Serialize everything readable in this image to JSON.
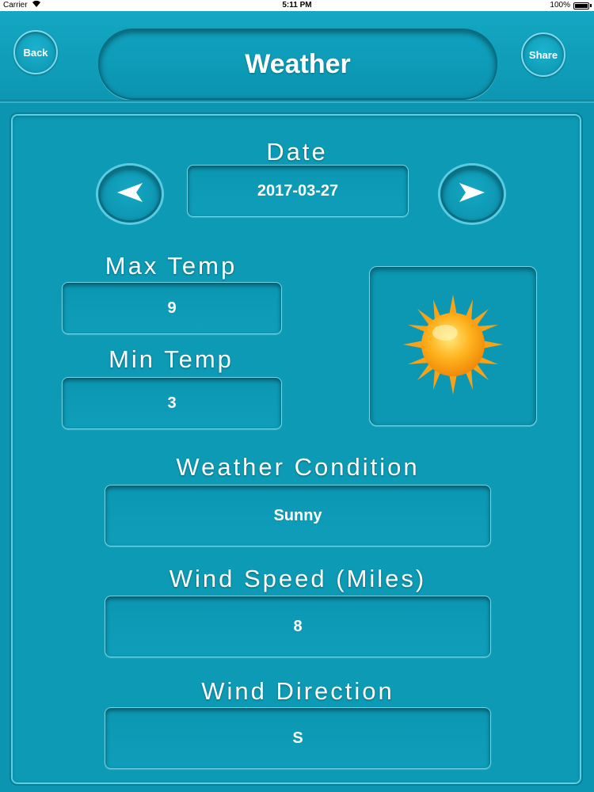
{
  "status_bar": {
    "carrier": "Carrier",
    "time": "5:11 PM",
    "battery": "100%"
  },
  "header": {
    "back_label": "Back",
    "title": "Weather",
    "share_label": "Share"
  },
  "date_section": {
    "label": "Date",
    "value": "2017-03-27",
    "prev_icon": "left-arrow-icon",
    "next_icon": "right-arrow-icon"
  },
  "temps": {
    "max_label": "Max Temp",
    "max_value": "9",
    "min_label": "Min Temp",
    "min_value": "3"
  },
  "weather_icon": "sun-icon",
  "condition": {
    "label": "Weather Condition",
    "value": "Sunny"
  },
  "wind_speed": {
    "label": "Wind Speed (Miles)",
    "value": "8"
  },
  "wind_direction": {
    "label": "Wind Direction",
    "value": "S"
  },
  "colors": {
    "background": "#0b95b0",
    "text": "#ffffff"
  }
}
